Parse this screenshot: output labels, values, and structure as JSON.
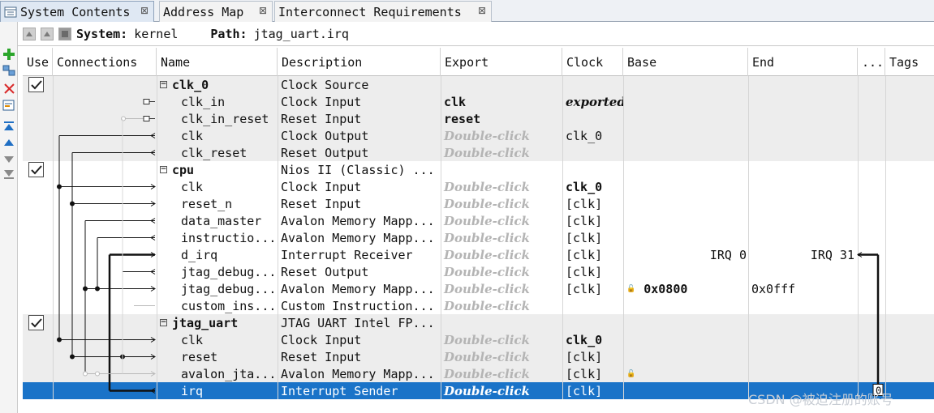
{
  "tabs": [
    {
      "label": "System Contents",
      "active": true
    },
    {
      "label": "Address Map",
      "active": false
    },
    {
      "label": "Interconnect Requirements",
      "active": false
    }
  ],
  "tab_close_glyph": "⊠",
  "pathbar": {
    "system_label": "System:",
    "system_value": "kernel",
    "path_label": "Path:",
    "path_value": "jtag_uart.irq"
  },
  "columns": {
    "use": "Use",
    "connections": "Connections",
    "name": "Name",
    "description": "Description",
    "export": "Export",
    "clock": "Clock",
    "base": "Base",
    "end": "End",
    "more": "...",
    "tags": "Tags"
  },
  "rows": [
    {
      "type": "module",
      "checked": true,
      "name": "clk_0",
      "description": "Clock Source",
      "export": "",
      "clock": "",
      "base": "",
      "end": "",
      "band": true
    },
    {
      "type": "port",
      "name": "clk_in",
      "description": "Clock Input",
      "export": "clk",
      "export_style": "bold",
      "clock": "exported",
      "clock_style": "exported",
      "base": "",
      "end": "",
      "band": true
    },
    {
      "type": "port",
      "name": "clk_in_reset",
      "description": "Reset Input",
      "export": "reset",
      "export_style": "bold",
      "clock": "",
      "base": "",
      "end": "",
      "band": true
    },
    {
      "type": "port",
      "name": "clk",
      "description": "Clock Output",
      "export": "Double-click",
      "export_style": "hint",
      "clock": "clk_0",
      "base": "",
      "end": "",
      "band": true
    },
    {
      "type": "port",
      "name": "clk_reset",
      "description": "Reset Output",
      "export": "Double-click",
      "export_style": "hint",
      "clock": "",
      "base": "",
      "end": "",
      "band": true
    },
    {
      "type": "module",
      "checked": true,
      "name": "cpu",
      "description": "Nios II (Classic) ...",
      "export": "",
      "clock": "",
      "base": "",
      "end": "",
      "band": false
    },
    {
      "type": "port",
      "name": "clk",
      "description": "Clock Input",
      "export": "Double-click",
      "export_style": "hint",
      "clock": "clk_0",
      "clock_style": "bold",
      "base": "",
      "end": "",
      "band": false
    },
    {
      "type": "port",
      "name": "reset_n",
      "description": "Reset Input",
      "export": "Double-click",
      "export_style": "hint",
      "clock": "[clk]",
      "base": "",
      "end": "",
      "band": false
    },
    {
      "type": "port",
      "name": "data_master",
      "description": "Avalon Memory Mapp...",
      "export": "Double-click",
      "export_style": "hint",
      "clock": "[clk]",
      "base": "",
      "end": "",
      "band": false
    },
    {
      "type": "port",
      "name": "instructio...",
      "description": "Avalon Memory Mapp...",
      "export": "Double-click",
      "export_style": "hint",
      "clock": "[clk]",
      "base": "",
      "end": "",
      "band": false
    },
    {
      "type": "port",
      "name": "d_irq",
      "description": "Interrupt Receiver",
      "export": "Double-click",
      "export_style": "hint",
      "clock": "[clk]",
      "base": "IRQ 0",
      "end": "IRQ 31",
      "band": false
    },
    {
      "type": "port",
      "name": "jtag_debug...",
      "description": "Reset Output",
      "export": "Double-click",
      "export_style": "hint",
      "clock": "[clk]",
      "base": "",
      "end": "",
      "band": false
    },
    {
      "type": "port",
      "name": "jtag_debug...",
      "description": "Avalon Memory Mapp...",
      "export": "Double-click",
      "export_style": "hint",
      "clock": "[clk]",
      "base": "0x0800",
      "base_style": "bold",
      "base_lock": true,
      "end": "0x0fff",
      "band": false
    },
    {
      "type": "port",
      "name": "custom_ins...",
      "description": "Custom Instruction...",
      "export": "Double-click",
      "export_style": "hint",
      "clock": "",
      "base": "",
      "end": "",
      "band": false
    },
    {
      "type": "module",
      "checked": true,
      "name": "jtag_uart",
      "description": "JTAG UART Intel FP...",
      "export": "",
      "clock": "",
      "base": "",
      "end": "",
      "band": true
    },
    {
      "type": "port",
      "name": "clk",
      "description": "Clock Input",
      "export": "Double-click",
      "export_style": "hint",
      "clock": "clk_0",
      "clock_style": "bold",
      "base": "",
      "end": "",
      "band": true
    },
    {
      "type": "port",
      "name": "reset",
      "description": "Reset Input",
      "export": "Double-click",
      "export_style": "hint",
      "clock": "[clk]",
      "base": "",
      "end": "",
      "band": true
    },
    {
      "type": "port",
      "name": "avalon_jta...",
      "description": "Avalon Memory Mapp...",
      "export": "Double-click",
      "export_style": "hint",
      "clock": "[clk]",
      "base": "",
      "base_lock": true,
      "end": "",
      "band": true
    },
    {
      "type": "port",
      "name": "irq",
      "description": "Interrupt Sender",
      "export": "Double-click",
      "export_style": "hint",
      "clock": "[clk]",
      "base": "",
      "end": "",
      "band": false,
      "selected": true
    }
  ],
  "irq_number": "0",
  "watermark": "CSDN @被迫注册的账号"
}
